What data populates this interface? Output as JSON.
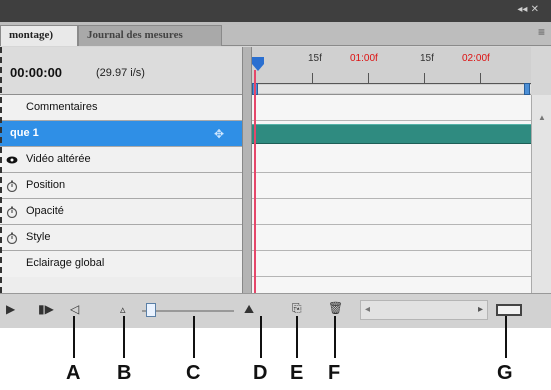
{
  "tabs": [
    {
      "label": "montage)"
    },
    {
      "label": "Journal des mesures"
    }
  ],
  "timeline": {
    "timecode": "00:00:00",
    "fps": "(29.97 i/s)",
    "ruler_labels": [
      {
        "text": "15f",
        "color": "#333333"
      },
      {
        "text": "01:00f",
        "color": "#dd1111"
      },
      {
        "text": "15f",
        "color": "#333333"
      },
      {
        "text": "02:00f",
        "color": "#dd1111"
      }
    ]
  },
  "layers": [
    {
      "label": "Commentaires",
      "icon": "none",
      "selected": false
    },
    {
      "label": "que 1",
      "icon": "none",
      "selected": true
    },
    {
      "label": "Vidéo altérée",
      "icon": "eye-icon",
      "selected": false
    },
    {
      "label": "Position",
      "icon": "stopwatch-icon",
      "selected": false
    },
    {
      "label": "Opacité",
      "icon": "stopwatch-icon",
      "selected": false
    },
    {
      "label": "Style",
      "icon": "stopwatch-icon",
      "selected": false
    },
    {
      "label": "Eclairage global",
      "icon": "none",
      "selected": false
    }
  ],
  "callouts": [
    "A",
    "B",
    "C",
    "D",
    "E",
    "F",
    "G"
  ],
  "colors": {
    "selection": "#2f8fe6",
    "track_bar": "#2f8b80",
    "cti": "#e5476a"
  }
}
